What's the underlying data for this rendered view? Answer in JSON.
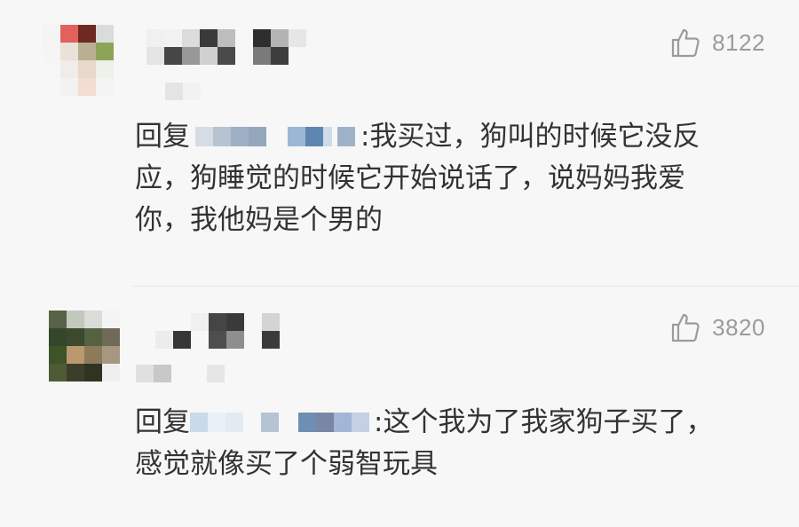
{
  "comments": [
    {
      "likes": "8122",
      "reply_prefix": "回复",
      "reply_text": ":我买过，狗叫的时候它没反应，狗睡觉的时候它开始说话了，说妈妈我爱你，我他妈是个男的"
    },
    {
      "likes": "3820",
      "reply_prefix": "回复",
      "reply_text": ":这个我为了我家狗子买了，感觉就像买了个弱智玩具"
    }
  ],
  "icons": {
    "like": "thumbs-up-outline-icon"
  },
  "colors": {
    "background": "#f7f7f7",
    "text": "#333333",
    "like_gray": "#9b9b9b",
    "divider": "#e4e4e4"
  }
}
